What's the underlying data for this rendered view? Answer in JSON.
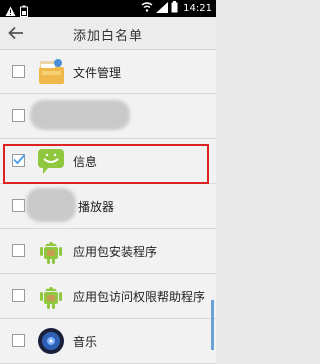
{
  "status_bar": {
    "time": "14:21",
    "icons": [
      "warning-icon",
      "battery-status-icon",
      "wifi-icon",
      "signal-icon",
      "battery-icon"
    ]
  },
  "header": {
    "title": "添加白名单"
  },
  "items": [
    {
      "label": "文件管理",
      "checked": false,
      "icon": "file-manager-icon"
    },
    {
      "label": "",
      "checked": false,
      "icon": "redacted-icon"
    },
    {
      "label": "信息",
      "checked": true,
      "icon": "messaging-icon"
    },
    {
      "label": "播放器",
      "checked": false,
      "icon": "redacted-icon"
    },
    {
      "label": "应用包安装程序",
      "checked": false,
      "icon": "android-package-icon"
    },
    {
      "label": "应用包访问权限帮助程序",
      "checked": false,
      "icon": "android-package-icon"
    },
    {
      "label": "音乐",
      "checked": false,
      "icon": "music-icon"
    }
  ],
  "colors": {
    "accent": "#4a9ee8",
    "highlight": "#dd2222"
  }
}
